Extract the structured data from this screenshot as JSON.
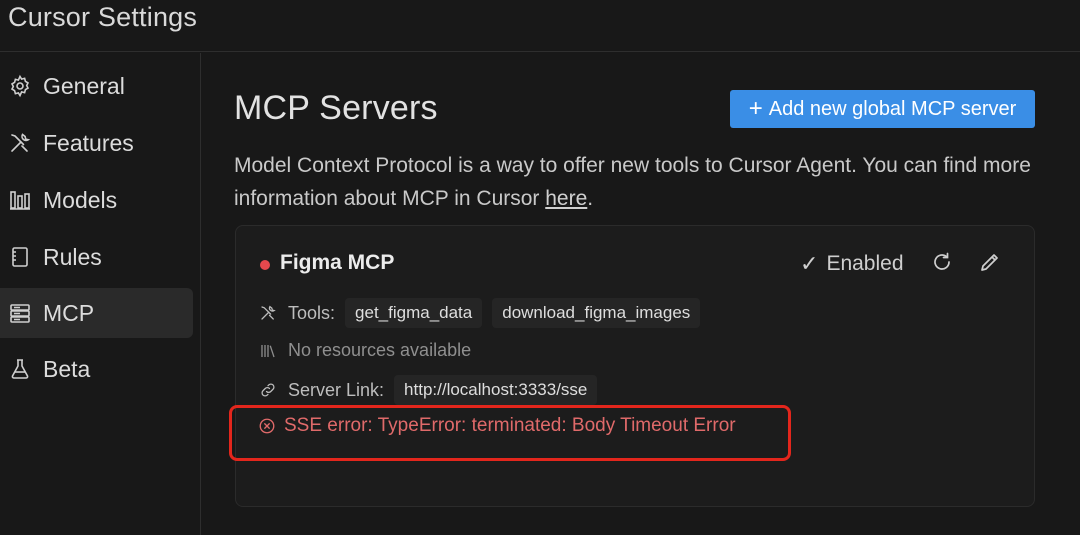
{
  "window": {
    "title": "Cursor Settings"
  },
  "sidebar": {
    "items": [
      {
        "label": "General",
        "icon": "gear-icon"
      },
      {
        "label": "Features",
        "icon": "tools-icon"
      },
      {
        "label": "Models",
        "icon": "models-icon"
      },
      {
        "label": "Rules",
        "icon": "rules-icon"
      },
      {
        "label": "MCP",
        "icon": "server-icon",
        "active": true
      },
      {
        "label": "Beta",
        "icon": "flask-icon"
      }
    ]
  },
  "main": {
    "title": "MCP Servers",
    "add_button_label": "Add new global MCP server",
    "description_prefix": "Model Context Protocol is a way to offer new tools to Cursor Agent. You can find more information about MCP in Cursor ",
    "description_link": "here",
    "description_suffix": "."
  },
  "server": {
    "name": "Figma MCP",
    "status": "Enabled",
    "tools_label": "Tools:",
    "tools": [
      "get_figma_data",
      "download_figma_images"
    ],
    "resources_text": "No resources available",
    "server_link_label": "Server Link:",
    "server_link": "http://localhost:3333/sse",
    "error": "SSE error: TypeError: terminated: Body Timeout Error"
  },
  "colors": {
    "accent": "#3a8ee6",
    "status_dot": "#e5484d",
    "error_text": "#e06a6a",
    "highlight_border": "#e3261c"
  }
}
